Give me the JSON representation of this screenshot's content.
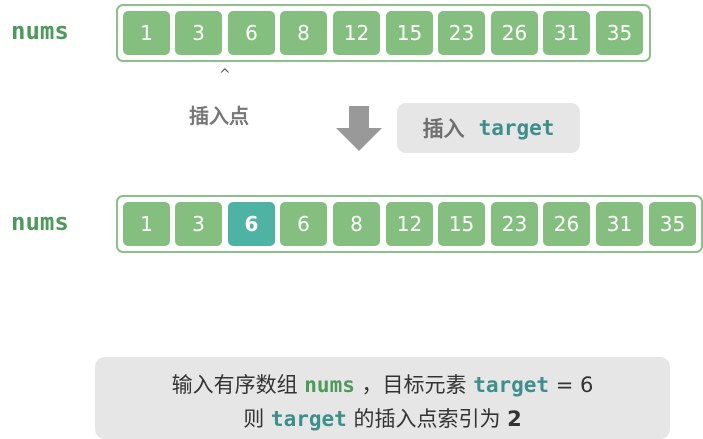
{
  "top_array": {
    "label": "nums",
    "values": [
      "1",
      "3",
      "6",
      "8",
      "12",
      "15",
      "23",
      "26",
      "31",
      "35"
    ]
  },
  "insertion_marker": {
    "caret": "^",
    "label": "插入点"
  },
  "action": {
    "verb": "插入",
    "code": "target"
  },
  "bottom_array": {
    "label": "nums",
    "values": [
      "1",
      "3",
      "6",
      "6",
      "8",
      "12",
      "15",
      "23",
      "26",
      "31",
      "35"
    ],
    "highlight_index": 2
  },
  "caption": {
    "line1": {
      "prefix": "输入有序数组 ",
      "code1": "nums",
      "middle": " ，目标元素 ",
      "code2": "target",
      "suffix": " = 6"
    },
    "line2": {
      "prefix": "则 ",
      "code": "target",
      "middle": " 的插入点索引为 ",
      "index": "2"
    }
  },
  "colors": {
    "cell": "#84bf80",
    "cell_highlight": "#4fb3a4",
    "frame": "#8cc08b",
    "label": "#4d9a5a",
    "code": "#3d8f8a",
    "panel": "#e6e6e6"
  }
}
